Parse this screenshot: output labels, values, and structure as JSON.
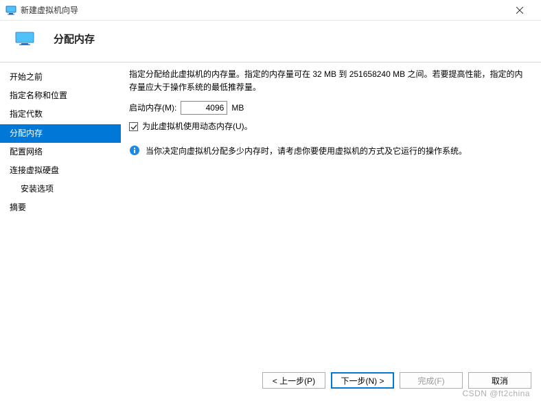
{
  "window": {
    "title": "新建虚拟机向导"
  },
  "header": {
    "title": "分配内存"
  },
  "sidebar": {
    "items": [
      {
        "label": "开始之前"
      },
      {
        "label": "指定名称和位置"
      },
      {
        "label": "指定代数"
      },
      {
        "label": "分配内存"
      },
      {
        "label": "配置网络"
      },
      {
        "label": "连接虚拟硬盘"
      },
      {
        "label": "安装选项"
      },
      {
        "label": "摘要"
      }
    ],
    "active_index": 3
  },
  "content": {
    "description_prefix": "指定分配给此虚拟机的内存量。指定的内存量可在 ",
    "min_mem": "32 MB",
    "description_mid": " 到 ",
    "max_mem": "251658240 MB",
    "description_suffix": " 之间。若要提高性能，指定的内存量应大于操作系统的最低推荐量。",
    "mem_label": "启动内存(M):",
    "mem_value": "4096",
    "mem_unit": "MB",
    "dynamic_label": "为此虚拟机使用动态内存(U)。",
    "dynamic_checked": true,
    "info_text": "当你决定向虚拟机分配多少内存时，请考虑你要使用虚拟机的方式及它运行的操作系统。"
  },
  "buttons": {
    "prev": "< 上一步(P)",
    "next": "下一步(N) >",
    "finish": "完成(F)",
    "cancel": "取消"
  },
  "watermark": "CSDN @ft2china"
}
